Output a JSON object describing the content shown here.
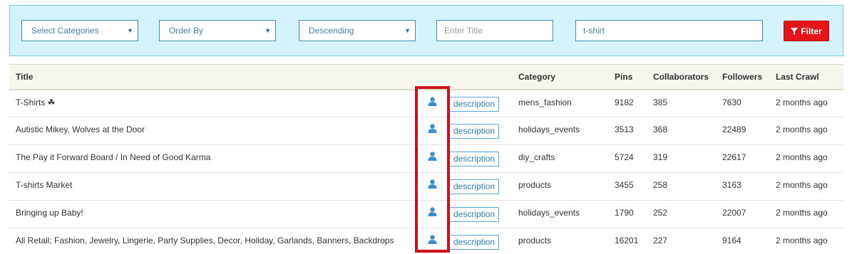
{
  "filters": {
    "categories": "Select Categories",
    "order_by": "Order By",
    "direction": "Descending",
    "title_placeholder": "Enter Title",
    "keyword": "t-shirt",
    "filter_label": "Filter",
    "chevron": "▼"
  },
  "table": {
    "headers": {
      "title": "Title",
      "category": "Category",
      "pins": "Pins",
      "collaborators": "Collaborators",
      "followers": "Followers",
      "last_crawl": "Last Crawl"
    },
    "rows": [
      {
        "title": "T-Shirts ☘",
        "desc": "description",
        "category": "mens_fashion",
        "pins": "9182",
        "collaborators": "385",
        "followers": "7630",
        "last_crawl": "2 months ago"
      },
      {
        "title": "Autistic Mikey, Wolves at the Door",
        "desc": "description",
        "category": "holidays_events",
        "pins": "3513",
        "collaborators": "368",
        "followers": "22489",
        "last_crawl": "2 months ago"
      },
      {
        "title": "The Pay it Forward Board / In Need of Good Karma",
        "desc": "description",
        "category": "diy_crafts",
        "pins": "5724",
        "collaborators": "319",
        "followers": "22617",
        "last_crawl": "2 months ago"
      },
      {
        "title": "T-shirts Market",
        "desc": "description",
        "category": "products",
        "pins": "3455",
        "collaborators": "258",
        "followers": "3163",
        "last_crawl": "2 months ago"
      },
      {
        "title": "Bringing up Baby!",
        "desc": "description",
        "category": "holidays_events",
        "pins": "1790",
        "collaborators": "252",
        "followers": "22007",
        "last_crawl": "2 months ago"
      },
      {
        "title": "All Retail; Fashion, Jewelry, Lingerie, Party Supplies, Decor, Holiday, Garlands, Banners, Backdrops",
        "desc": "description",
        "category": "products",
        "pins": "16201",
        "collaborators": "227",
        "followers": "9164",
        "last_crawl": "2 months ago"
      }
    ]
  },
  "colors": {
    "filter_bar_bg": "#d4f3fb",
    "filter_button": "#e5141b",
    "accent_blue": "#2f80b8",
    "highlight_red": "#d01016"
  },
  "icons": {
    "row_icon": "user-icon",
    "filter_icon": "funnel-icon"
  }
}
